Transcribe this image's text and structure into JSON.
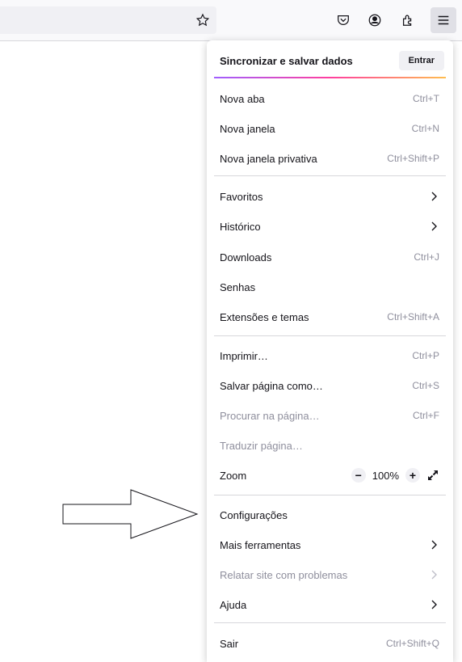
{
  "toolbar": {
    "icons": [
      "bookmark-star-icon",
      "pocket-icon",
      "account-icon",
      "extensions-icon",
      "menu-icon"
    ]
  },
  "menu": {
    "sync_title": "Sincronizar e salvar dados",
    "sign_in": "Entrar",
    "new_tab": {
      "label": "Nova aba",
      "shortcut": "Ctrl+T"
    },
    "new_window": {
      "label": "Nova janela",
      "shortcut": "Ctrl+N"
    },
    "private_window": {
      "label": "Nova janela privativa",
      "shortcut": "Ctrl+Shift+P"
    },
    "bookmarks": {
      "label": "Favoritos"
    },
    "history": {
      "label": "Histórico"
    },
    "downloads": {
      "label": "Downloads",
      "shortcut": "Ctrl+J"
    },
    "passwords": {
      "label": "Senhas"
    },
    "addons": {
      "label": "Extensões e temas",
      "shortcut": "Ctrl+Shift+A"
    },
    "print": {
      "label": "Imprimir…",
      "shortcut": "Ctrl+P"
    },
    "save_page": {
      "label": "Salvar página como…",
      "shortcut": "Ctrl+S"
    },
    "find": {
      "label": "Procurar na página…",
      "shortcut": "Ctrl+F"
    },
    "translate": {
      "label": "Traduzir página…"
    },
    "zoom": {
      "label": "Zoom",
      "minus": "−",
      "value": "100%",
      "plus": "+"
    },
    "settings": {
      "label": "Configurações"
    },
    "more_tools": {
      "label": "Mais ferramentas"
    },
    "report_site": {
      "label": "Relatar site com problemas"
    },
    "help": {
      "label": "Ajuda"
    },
    "quit": {
      "label": "Sair",
      "shortcut": "Ctrl+Shift+Q"
    }
  }
}
